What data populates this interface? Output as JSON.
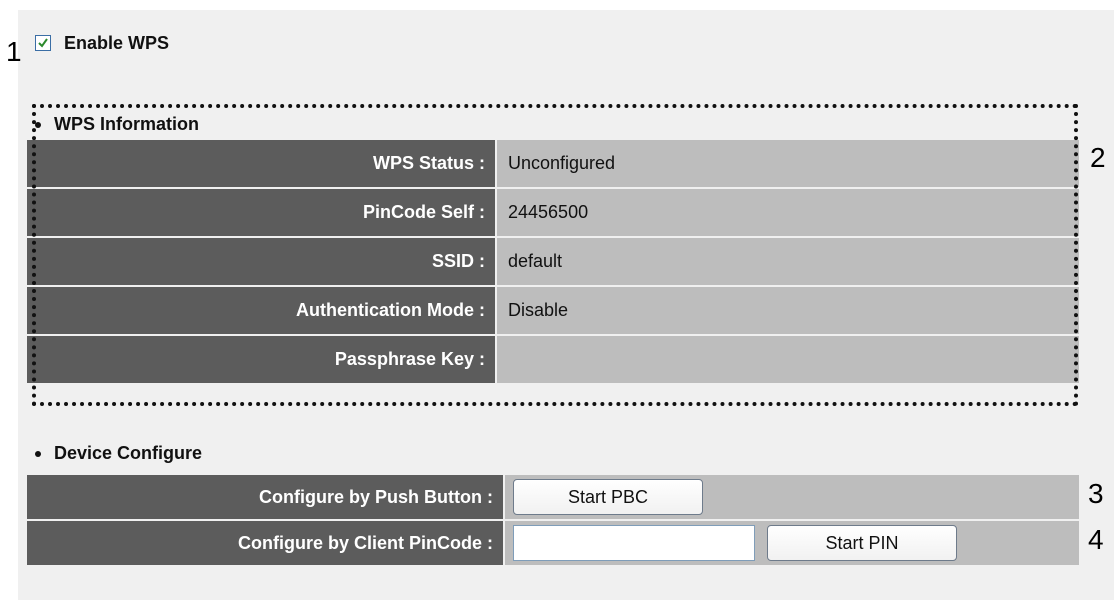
{
  "callouts": {
    "one": "1",
    "two": "2",
    "three": "3",
    "four": "4"
  },
  "enable_wps": {
    "label": "Enable WPS",
    "checked": true
  },
  "wps_information": {
    "title": "WPS Information",
    "rows": [
      {
        "label": "WPS Status :",
        "value": "Unconfigured"
      },
      {
        "label": "PinCode Self :",
        "value": "24456500"
      },
      {
        "label": "SSID :",
        "value": "default"
      },
      {
        "label": "Authentication Mode :",
        "value": "Disable"
      },
      {
        "label": "Passphrase Key :",
        "value": ""
      }
    ]
  },
  "device_configure": {
    "title": "Device Configure",
    "push_button": {
      "label": "Configure by Push Button :",
      "button_label": "Start PBC"
    },
    "client_pin": {
      "label": "Configure by Client PinCode :",
      "input_value": "",
      "button_label": "Start PIN"
    }
  },
  "colors": {
    "label_bg": "#5c5c5c",
    "value_bg": "#bdbdbd",
    "panel_bg": "#f0f0f0",
    "checkbox_border": "#3b6ea5",
    "checkmark": "#2c8a2c"
  },
  "icons": {
    "checkbox": "checkmark-icon",
    "bullet": "bullet-icon"
  }
}
